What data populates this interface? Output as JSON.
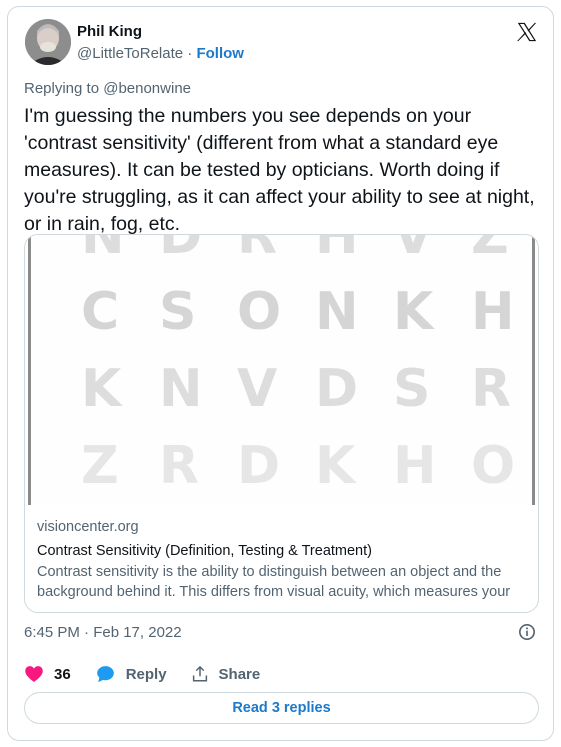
{
  "author": {
    "name": "Phil King",
    "handle": "@LittleToRelate",
    "separator": "·",
    "follow_label": "Follow"
  },
  "reply_context": "Replying to @benonwine",
  "tweet_text": "I'm guessing the numbers you see depends on your 'contrast sensitivity' (different from what a standard eye measures). It can be tested by opticians. Worth doing if you're struggling, as it can affect your ability to see at night, or in rain, fog, etc.",
  "link_card": {
    "chart_rows": [
      {
        "letters": [
          "N",
          "D",
          "R",
          "H",
          "V",
          "Z"
        ],
        "color": "#dddddd"
      },
      {
        "letters": [
          "C",
          "S",
          "O",
          "N",
          "K",
          "H"
        ],
        "color": "#d5d5d5"
      },
      {
        "letters": [
          "K",
          "N",
          "V",
          "D",
          "S",
          "R"
        ],
        "color": "#dddddd"
      },
      {
        "letters": [
          "Z",
          "R",
          "D",
          "K",
          "H",
          "O"
        ],
        "color": "#e6e6e6"
      }
    ],
    "domain": "visioncenter.org",
    "title": "Contrast Sensitivity (Definition, Testing & Treatment)",
    "description": "Contrast sensitivity is the ability to distinguish between an object and the background behind it. This differs from visual acuity, which measures your"
  },
  "timestamp": "6:45 PM · Feb 17, 2022",
  "actions": {
    "likes": "36",
    "reply_label": "Reply",
    "share_label": "Share"
  },
  "read_replies_label": "Read 3 replies",
  "colors": {
    "link": "#1d79c9",
    "like": "#f91880",
    "reply_icon": "#1d9bf0",
    "border": "#cfd9de"
  },
  "icons": [
    "x-logo-icon",
    "info-icon",
    "heart-icon",
    "reply-bubble-icon",
    "share-icon"
  ]
}
